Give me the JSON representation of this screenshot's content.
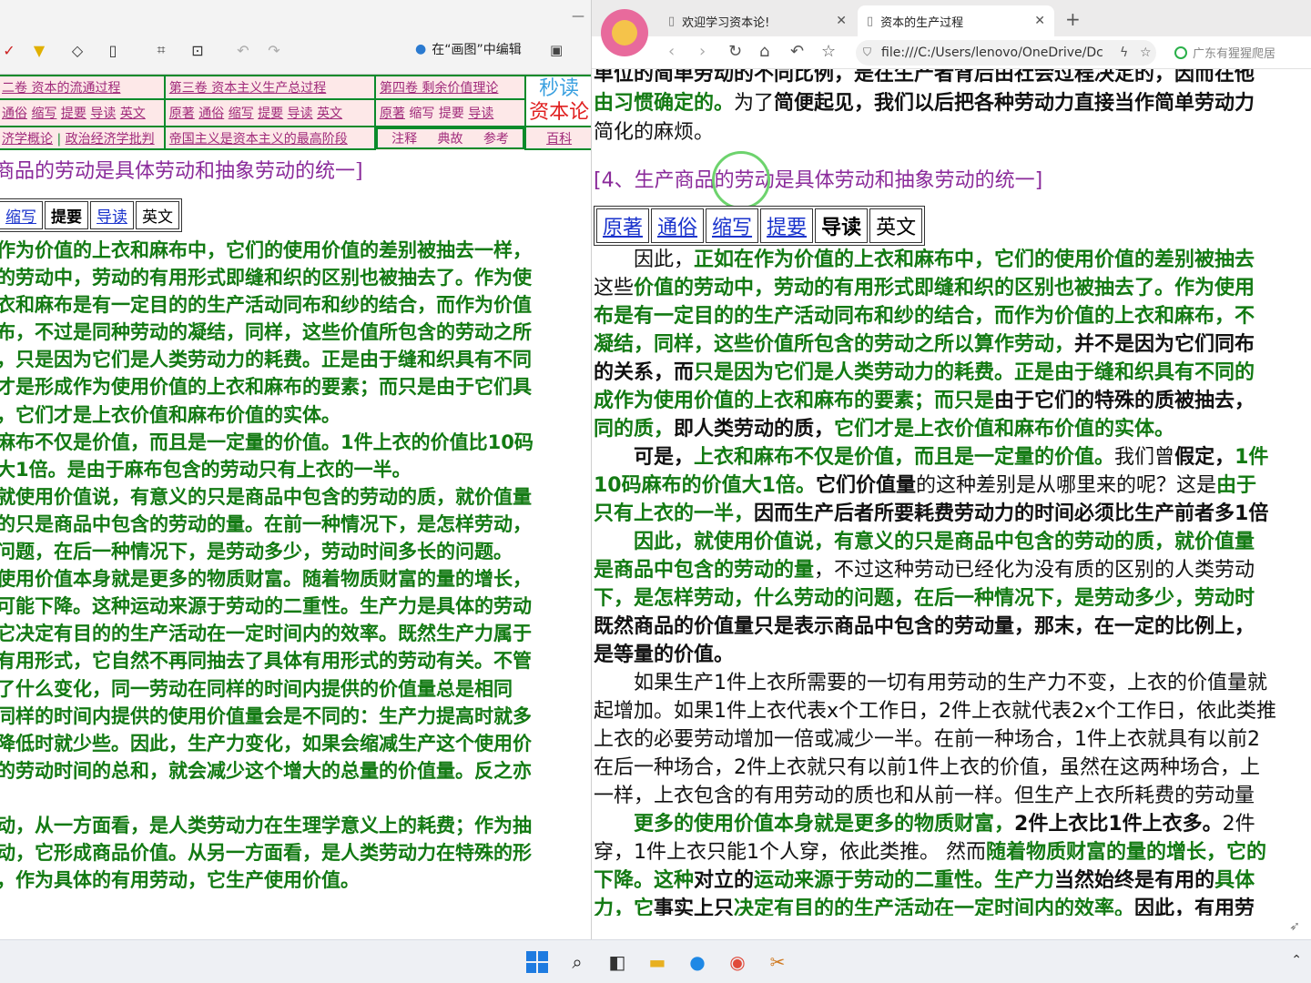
{
  "left": {
    "toolbar": {
      "paint_edit": "在“画图”中编辑"
    },
    "nav": {
      "r1": [
        "二卷 资本的流通过程",
        "第三卷 资本主义生产总过程",
        "第四卷 剩余价值理论"
      ],
      "r2a": [
        "通俗",
        "缩写",
        "提要",
        "导读",
        "英文"
      ],
      "r2b": [
        "原著",
        "通俗",
        "缩写",
        "提要",
        "导读",
        "英文"
      ],
      "r2c": [
        "原著",
        "缩写",
        "提要",
        "导读"
      ],
      "r3": [
        "济学概论",
        "政治经济学批判",
        "帝国主义是资本主义的最高阶段",
        "注释",
        "典故",
        "参考",
        "百科"
      ],
      "miaodu": "秒读",
      "zibenlun": "资本论"
    },
    "title": "商品的劳动是具体劳动和抽象劳动的统一]",
    "buttons": [
      "缩写",
      "提要",
      "导读",
      "英文"
    ],
    "lines": [
      "作为价值的上衣和麻布中，它们的使用价值的差别被抽去一样，",
      "的劳动中，劳动的有用形式即缝和织的区别也被抽去了。作为使",
      "衣和麻布是有一定目的的生产活动同布和纱的结合，而作为价值",
      "布，不过是同种劳动的凝结，同样，这些价值所包含的劳动之所",
      "，只是因为它们是人类劳动力的耗费。正是由于缝和织具有不同",
      "才是形成作为使用价值的上衣和麻布的要素；而只是由于它们具",
      "，它们才是上衣价值和麻布价值的实体。",
      "麻布不仅是价值，而且是一定量的价值。1件上衣的价值比10码",
      "大1倍。是由于麻布包含的劳动只有上衣的一半。",
      "就使用价值说，有意义的只是商品中包含的劳动的质，就价值量",
      "的只是商品中包含的劳动的量。在前一种情况下，是怎样劳动，",
      "问题，在后一种情况下，是劳动多少，劳动时间多长的问题。",
      "使用价值本身就是更多的物质财富。随着物质财富的量的增长，",
      "可能下降。这种运动来源于劳动的二重性。生产力是具体的劳动",
      "它决定有目的的生产活动在一定时间内的效率。既然生产力属于",
      "有用形式，它自然不再同抽去了具体有用形式的劳动有关。不管",
      "了什么变化，同一劳动在同样的时间内提供的价值量总是相同",
      "同样的时间内提供的使用价值量会是不同的：生产力提高时就多",
      "降低时就少些。因此，生产力变化，如果会缩减生产这个使用价",
      "的劳动时间的总和，就会减少这个增大的总量的价值量。反之亦",
      "",
      "动，从一方面看，是人类劳动力在生理学意义上的耗费；作为抽",
      "动，它形成商品价值。从另一方面看，是人类劳动力在特殊的形",
      "，作为具体的有用劳动，它生产使用价值。"
    ]
  },
  "right": {
    "tabs": [
      {
        "label": "欢迎学习资本论!"
      },
      {
        "label": "资本的生产过程"
      }
    ],
    "address": "file:///C:/Users/lenovo/OneDrive/Dc",
    "search_placeholder": "广东有猩猩爬居",
    "top": {
      "l1a": "单位的简单劳动的不同比例，是在生产者背后由社会过程决定的，因而在他",
      "l2a": "由习惯确定的。",
      "l2b": "为了",
      "l2c": "简便起见，我们以后把各种劳动力直接当作简单劳动力",
      "l3": "简化的麻烦。"
    },
    "title": "[4、生产商品的劳动是具体劳动和抽象劳动的统一]",
    "buttons": [
      "原著",
      "通俗",
      "缩写",
      "提要",
      "导读",
      "英文"
    ],
    "p": {
      "a1": "因此，",
      "a2": "正如在作为价值的上衣和麻布中，它们的使用价值的差别被抽去",
      "b1": "这些",
      "b2": "价值的劳动中，劳动的有用形式即",
      "b3": "缝和织的区别也被抽去了。作为使用",
      "c": "布是有一定目的的生产活动同布和纱的结合，而作为价值的上衣和麻布，不",
      "d1": "凝结，同样，这些价值所包含的劳动之所以算作劳动，",
      "d2": "并不是因为它们同布",
      "e1": "的关系，而",
      "e2": "只是因为它们是人类劳动力的耗费。正是由于缝和织具有不同的",
      "f1": "成作为使用价值的上衣和麻布的要素；而只是",
      "f2": "由于它们的特殊的质被抽去，",
      "g1": "同的质，",
      "g2": "即人类劳动的质，",
      "g3": "它们才是上衣价值和麻布价值的实体。",
      "h1": "可是，",
      "h2": "上衣和麻布不仅是价值，而且是一定量的价值。",
      "h3": "我们曾",
      "h4": "假定，",
      "h5": "1件",
      "i1": "10码麻布的价值大1倍。",
      "i2": "它们价值量",
      "i3": "的这种差别是从哪里来的呢？这是",
      "i4": "由于",
      "j1": "只有上衣的一半，",
      "j2": "因而生产后者所要耗费劳动力的时间必须比生产前者多1倍",
      "k": "因此，就使用价值说，有意义的只是商品中包含的劳动的质，就价值量",
      "l1": "是商品中包含的劳动的量",
      "l2": "，不过这种劳动已经化为没有质的区别的人类劳动",
      "m": "下，是怎样劳动，什么劳动的问题，在后一种情况下，是劳动多少，劳动时",
      "n": "既然商品的价值量只是表示商品中包含的劳动量，那末，在一定的比例上，",
      "o": "是等量的价值。",
      "p1": "如果生产1件上衣所需要的一切有用劳动的生产力不变，上衣的价值量就",
      "p2": "起增加。如果1件上衣代表x个工作日，2件上衣就代表2x个工作日，依此类推",
      "p3": "上衣的必要劳动增加一倍或减少一半。在前一种场合，1件上衣就具有以前2",
      "p4": "在后一种场合，2件上衣就只有以前1件上衣的价值，虽然在这两种场合，上",
      "p5": "一样，上衣包含的有用劳动的质也和从前一样。但生产上衣所耗费的劳动量",
      "q1": "更多的使用价值本身就是更多的物质财富，",
      "q2": "2件上衣比1件上衣多。",
      "q3": "2件",
      "r1": "穿，1件上衣只能1个人穿，依此类推。 然而",
      "r2": "随着物质财富的量的增长，它的",
      "s1": "下降。这种",
      "s2": "对立的",
      "s3": "运动来源于劳动的二重性。生产力",
      "s4": "当然始终是",
      "s5": "有用的",
      "s6": "具体",
      "t1": "力，它",
      "t2": "事实上只",
      "t3": "决定有目的的生产活动在一定时间内的效率。",
      "t4": "因此，有用劳"
    }
  }
}
